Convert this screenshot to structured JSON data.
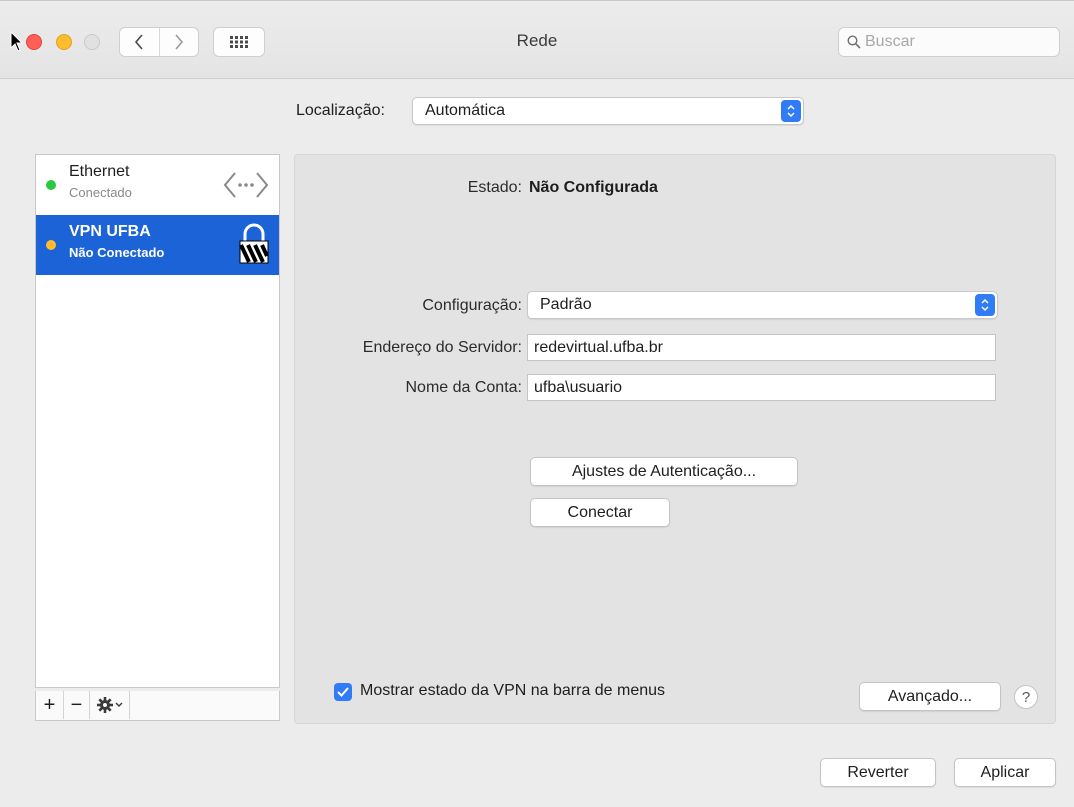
{
  "window": {
    "title": "Rede",
    "search_placeholder": "Buscar"
  },
  "location": {
    "label": "Localização:",
    "value": "Automática"
  },
  "services": [
    {
      "name": "Ethernet",
      "status": "Conectado",
      "status_color": "#28c840",
      "icon": "ethernet-arrows-icon",
      "selected": false
    },
    {
      "name": "VPN UFBA",
      "status": "Não Conectado",
      "status_color": "#febc2e",
      "icon": "vpn-lock-icon",
      "selected": true
    }
  ],
  "sidebar_tools": {
    "add": "+",
    "remove": "−"
  },
  "detail": {
    "state_label": "Estado:",
    "state_value": "Não Configurada",
    "config_label": "Configuração:",
    "config_value": "Padrão",
    "server_label": "Endereço do Servidor:",
    "server_value": "redevirtual.ufba.br",
    "account_label": "Nome da Conta:",
    "account_value": "ufba\\usuario",
    "auth_button": "Ajustes de Autenticação...",
    "connect_button": "Conectar",
    "show_vpn_status_label": "Mostrar estado da VPN na barra de menus",
    "show_vpn_status_checked": true,
    "advanced_button": "Avançado...",
    "help_button": "?"
  },
  "footer": {
    "revert_button": "Reverter",
    "apply_button": "Aplicar"
  },
  "colors": {
    "accent": "#2f7cf6",
    "selection": "#1b63d7"
  }
}
